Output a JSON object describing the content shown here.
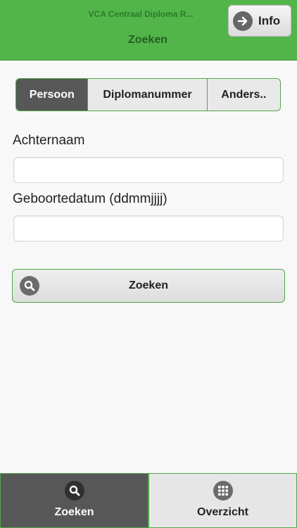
{
  "header": {
    "app_title": "VCA Centraal Diploma R...",
    "page_title": "Zoeken",
    "info_label": "Info"
  },
  "segments": [
    {
      "label": "Persoon",
      "active": true
    },
    {
      "label": "Diplomanummer",
      "active": false
    },
    {
      "label": "Anders..",
      "active": false
    }
  ],
  "form": {
    "lastname_label": "Achternaam",
    "lastname_value": "",
    "birthdate_label": "Geboortedatum (ddmmjjjj)",
    "birthdate_value": ""
  },
  "search_button": {
    "label": "Zoeken"
  },
  "tabbar": {
    "tabs": [
      {
        "label": "Zoeken",
        "icon": "search-icon",
        "active": true
      },
      {
        "label": "Overzicht",
        "icon": "grid-icon",
        "active": false
      }
    ]
  },
  "colors": {
    "header_green": "#52b54a",
    "border_green": "#52a64a",
    "active_dark": "#575757"
  }
}
